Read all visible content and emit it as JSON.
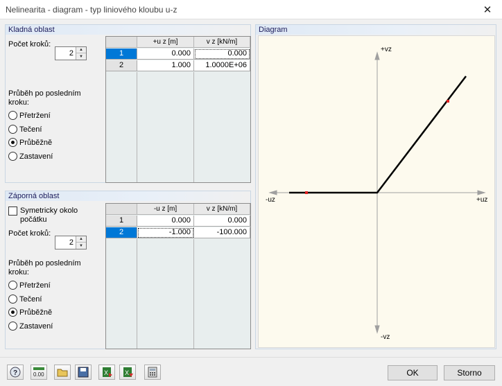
{
  "window": {
    "title": "Nelinearita - diagram - typ liniového kloubu u-z",
    "close_glyph": "✕"
  },
  "positive": {
    "heading": "Kladná oblast",
    "steps_label": "Počet kroků:",
    "steps_value": "2",
    "after_label_1": "Průběh po posledním",
    "after_label_2": "kroku:",
    "options": [
      "Přetržení",
      "Tečení",
      "Průběžně",
      "Zastavení"
    ],
    "selected": 2,
    "table": {
      "columns": [
        "+u z [m]",
        "v z [kN/m]"
      ],
      "rows": [
        {
          "n": "1",
          "u": "0.000",
          "v": "0.000"
        },
        {
          "n": "2",
          "u": "1.000",
          "v": "1.0000E+06"
        }
      ]
    }
  },
  "negative": {
    "heading": "Záporná oblast",
    "symmetric_1": "Symetricky okolo",
    "symmetric_2": "počátku",
    "steps_label": "Počet kroků:",
    "steps_value": "2",
    "after_label_1": "Průběh po posledním",
    "after_label_2": "kroku:",
    "options": [
      "Přetržení",
      "Tečení",
      "Průběžně",
      "Zastavení"
    ],
    "selected": 2,
    "table": {
      "columns": [
        "-u z [m]",
        "v z [kN/m]"
      ],
      "rows": [
        {
          "n": "1",
          "u": "0.000",
          "v": "0.000"
        },
        {
          "n": "2",
          "u": "-1.000",
          "v": "-100.000"
        }
      ]
    }
  },
  "diagram": {
    "heading": "Diagram",
    "axis_top": "+vz",
    "axis_bottom": "-vz",
    "axis_left": "-uz",
    "axis_right": "+uz",
    "line_color": "#000000",
    "point_color": "#e02020",
    "axis_color": "#a0a0a0"
  },
  "toolbar": {
    "icons": [
      "help-icon",
      "decimal-places-icon",
      "open-icon",
      "save-icon",
      "import-excel-icon",
      "export-excel-icon",
      "calculator-icon"
    ],
    "decimal_glyph": "0.00"
  },
  "buttons": {
    "ok": "OK",
    "cancel": "Storno"
  }
}
